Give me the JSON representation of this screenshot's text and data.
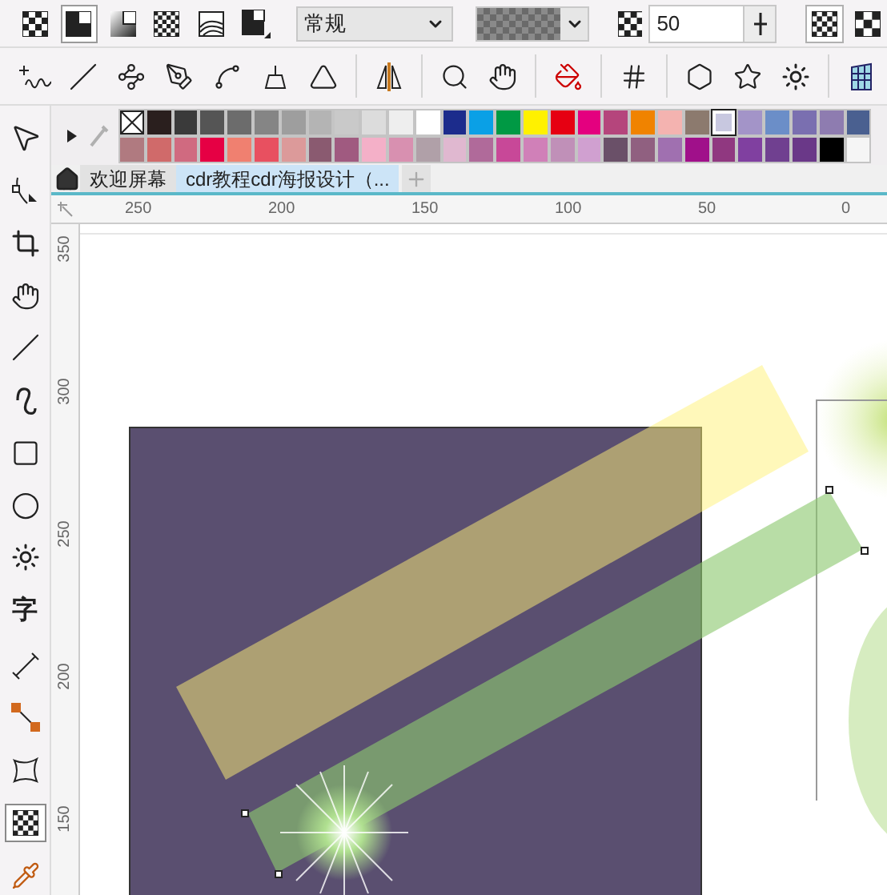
{
  "property_bar": {
    "transparency_types": [
      {
        "selected": false
      },
      {
        "selected": true
      },
      {
        "selected": false
      },
      {
        "selected": false
      },
      {
        "selected": false
      },
      {
        "selected": false
      }
    ],
    "merge_mode": {
      "value": "常规"
    },
    "transparency": {
      "value": "50"
    }
  },
  "toolbox": {
    "tools": [
      {
        "selected": false
      },
      {
        "selected": false
      },
      {
        "selected": false
      },
      {
        "selected": false
      },
      {
        "selected": false
      },
      {
        "selected": false
      },
      {
        "selected": false
      },
      {
        "selected": false
      },
      {
        "selected": false
      },
      {
        "selected": false,
        "glyph": "字"
      },
      {
        "selected": false
      },
      {
        "selected": false
      },
      {
        "selected": false
      },
      {
        "selected": true
      },
      {
        "selected": false
      }
    ]
  },
  "palette": {
    "rows": [
      [
        {
          "color": "#ffffff",
          "selected": false,
          "kind": "none"
        },
        {
          "color": "#2a1f1e",
          "selected": false
        },
        {
          "color": "#3a3a3a",
          "selected": false
        },
        {
          "color": "#555555",
          "selected": false
        },
        {
          "color": "#6c6c6c",
          "selected": false
        },
        {
          "color": "#858585",
          "selected": false
        },
        {
          "color": "#9e9e9e",
          "selected": false
        },
        {
          "color": "#b4b4b4",
          "selected": false
        },
        {
          "color": "#c9c9c9",
          "selected": false
        },
        {
          "color": "#dcdcdc",
          "selected": false
        },
        {
          "color": "#eeeeee",
          "selected": false
        },
        {
          "color": "#ffffff",
          "selected": false
        },
        {
          "color": "#1c2c8c",
          "selected": false
        },
        {
          "color": "#0aa0e6",
          "selected": false
        },
        {
          "color": "#009944",
          "selected": false
        },
        {
          "color": "#fff100",
          "selected": false
        },
        {
          "color": "#e60012",
          "selected": false
        },
        {
          "color": "#e4007f",
          "selected": false
        },
        {
          "color": "#b5457c",
          "selected": false
        },
        {
          "color": "#f08300",
          "selected": false
        },
        {
          "color": "#f4b3b0",
          "selected": false
        },
        {
          "color": "#8c7a6e",
          "selected": false
        },
        {
          "color": "#c8c8e0",
          "selected": true
        },
        {
          "color": "#a394c8",
          "selected": false
        },
        {
          "color": "#6b8ec8",
          "selected": false
        },
        {
          "color": "#7a6fb0",
          "selected": false
        },
        {
          "color": "#8e7cb0",
          "selected": false
        },
        {
          "color": "#4a6090",
          "selected": false
        }
      ],
      [
        {
          "color": "#b07a80",
          "selected": false
        },
        {
          "color": "#d06a6a",
          "selected": false
        },
        {
          "color": "#d06a80",
          "selected": false
        },
        {
          "color": "#e60044",
          "selected": false
        },
        {
          "color": "#f08070",
          "selected": false
        },
        {
          "color": "#e85060",
          "selected": false
        },
        {
          "color": "#dc9a9a",
          "selected": false
        },
        {
          "color": "#8a5a70",
          "selected": false
        },
        {
          "color": "#a05a80",
          "selected": false
        },
        {
          "color": "#f4b0c8",
          "selected": false
        },
        {
          "color": "#d890b0",
          "selected": false
        },
        {
          "color": "#b0a0a8",
          "selected": false
        },
        {
          "color": "#e0b8d0",
          "selected": false
        },
        {
          "color": "#b06a9a",
          "selected": false
        },
        {
          "color": "#c84898",
          "selected": false
        },
        {
          "color": "#d080b8",
          "selected": false
        },
        {
          "color": "#c090b8",
          "selected": false
        },
        {
          "color": "#d0a0d0",
          "selected": false
        },
        {
          "color": "#6a5068",
          "selected": false
        },
        {
          "color": "#906080",
          "selected": false
        },
        {
          "color": "#a070b0",
          "selected": false
        },
        {
          "color": "#a0108a",
          "selected": false
        },
        {
          "color": "#903880",
          "selected": false
        },
        {
          "color": "#8040a0",
          "selected": false
        },
        {
          "color": "#704090",
          "selected": false
        },
        {
          "color": "#6a3888",
          "selected": false
        },
        {
          "color": "#000000",
          "selected": false
        },
        {
          "color": "#f5f5f5",
          "selected": false
        }
      ]
    ]
  },
  "tabs": [
    {
      "label": "欢迎屏幕",
      "selected": false
    },
    {
      "label": "cdr教程cdr海报设计（...",
      "selected": true
    }
  ],
  "rulers": {
    "horizontal": [
      "250",
      "200",
      "150",
      "100",
      "50",
      "0"
    ],
    "vertical": [
      "350",
      "300",
      "250",
      "200",
      "150"
    ]
  }
}
